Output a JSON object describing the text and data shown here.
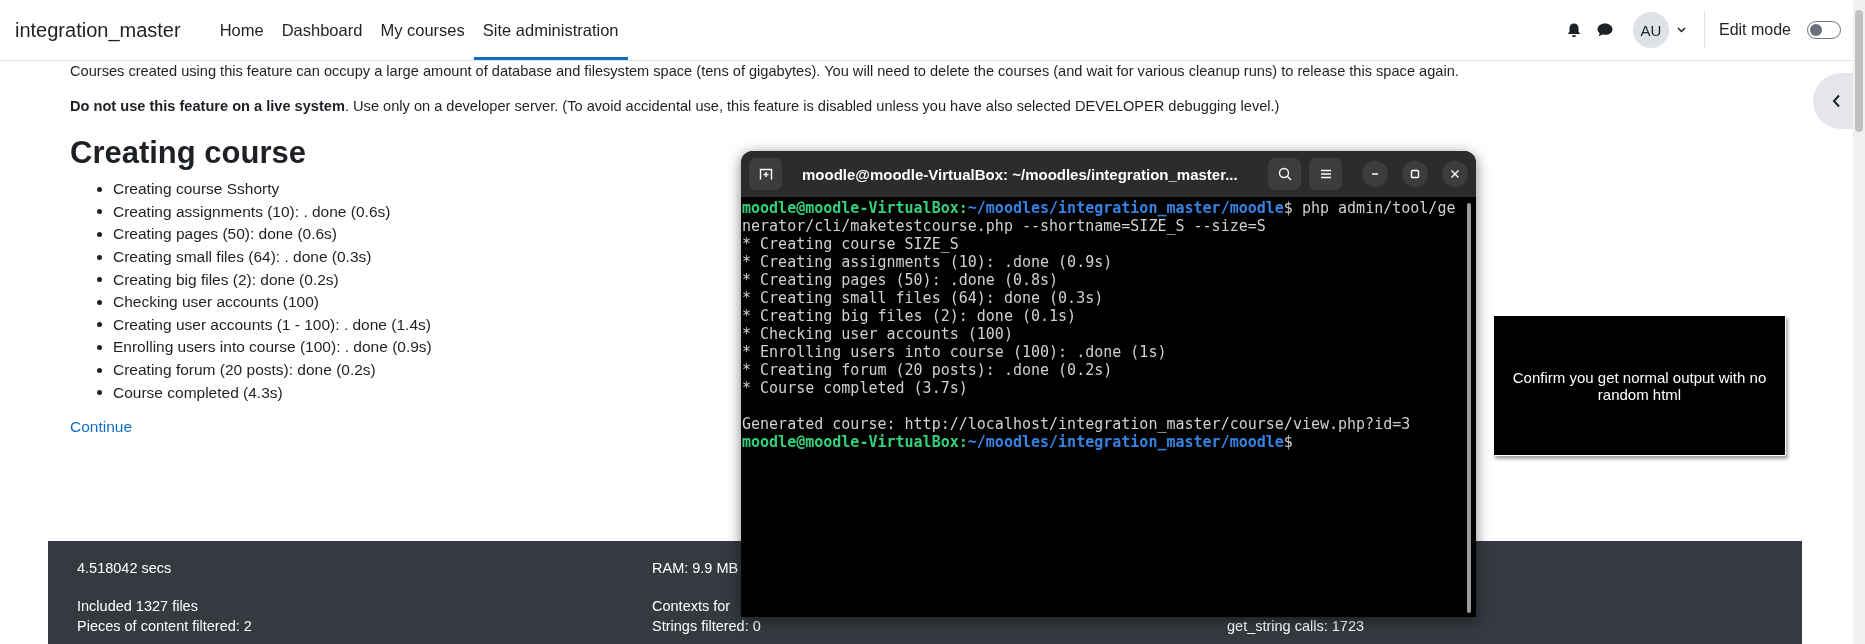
{
  "header": {
    "brand": "integration_master",
    "nav": [
      {
        "label": "Home",
        "selected": false
      },
      {
        "label": "Dashboard",
        "selected": false
      },
      {
        "label": "My courses",
        "selected": false
      },
      {
        "label": "Site administration",
        "selected": true
      }
    ],
    "user_initials": "AU",
    "edit_mode": {
      "label": "Edit mode",
      "on": false
    }
  },
  "intro": [
    "Courses created using this feature can occupy a large amount of database and filesystem space (tens of gigabytes). You will need to delete the courses (and wait for various cleanup runs) to release this space again.",
    "**Do not use this feature on a live system**. Use only on a developer server. (To avoid accidental use, this feature is disabled unless you have also selected DEVELOPER debugging level.)"
  ],
  "section": {
    "title": "Creating course",
    "steps": [
      "Creating course Sshorty",
      "Creating assignments (10): . done (0.6s)",
      "Creating pages (50): done (0.6s)",
      "Creating small files (64): . done (0.3s)",
      "Creating big files (2): done (0.2s)",
      "Checking user accounts (100)",
      "Creating user accounts (1 - 100): . done (1.4s)",
      "Enrolling users into course (100): . done (0.9s)",
      "Creating forum (20 posts): done (0.2s)",
      "Course completed (4.3s)"
    ],
    "continue_link": "Continue"
  },
  "terminal": {
    "title": "moodle@moodle-VirtualBox: ~/moodles/integration_master...",
    "lines": [
      {
        "kind": "prompt",
        "user": "moodle@moodle-VirtualBox:",
        "path": "~/moodles/integration_master/moodle",
        "command": "$ php admin/tool/generator/cli/maketestcourse.php --shortname=SIZE_S --size=S"
      },
      {
        "kind": "output",
        "text": "* Creating course SIZE_S"
      },
      {
        "kind": "output",
        "text": "* Creating assignments (10): .done (0.9s)"
      },
      {
        "kind": "output",
        "text": "* Creating pages (50): .done (0.8s)"
      },
      {
        "kind": "output",
        "text": "* Creating small files (64): done (0.3s)"
      },
      {
        "kind": "output",
        "text": "* Creating big files (2): done (0.1s)"
      },
      {
        "kind": "output",
        "text": "* Checking user accounts (100)"
      },
      {
        "kind": "output",
        "text": "* Enrolling users into course (100): .done (1s)"
      },
      {
        "kind": "output",
        "text": "* Creating forum (20 posts): .done (0.2s)"
      },
      {
        "kind": "output",
        "text": "* Course completed (3.7s)"
      },
      {
        "kind": "blank"
      },
      {
        "kind": "output",
        "text": "Generated course: http://localhost/integration_master/course/view.php?id=3"
      },
      {
        "kind": "prompt",
        "user": "moodle@moodle-VirtualBox:",
        "path": "~/moodles/integration_master/moodle",
        "command": "$"
      }
    ]
  },
  "note": "Confirm you get normal output with no random html",
  "footer": {
    "rows": [
      [
        "4.518042 secs",
        "RAM: 9.9 MB"
      ],
      [
        "Included 1327 files",
        "Contexts for"
      ],
      [
        "Pieces of content filtered: 2",
        "Strings filtered: 0",
        "get_string calls: 1723"
      ]
    ]
  }
}
